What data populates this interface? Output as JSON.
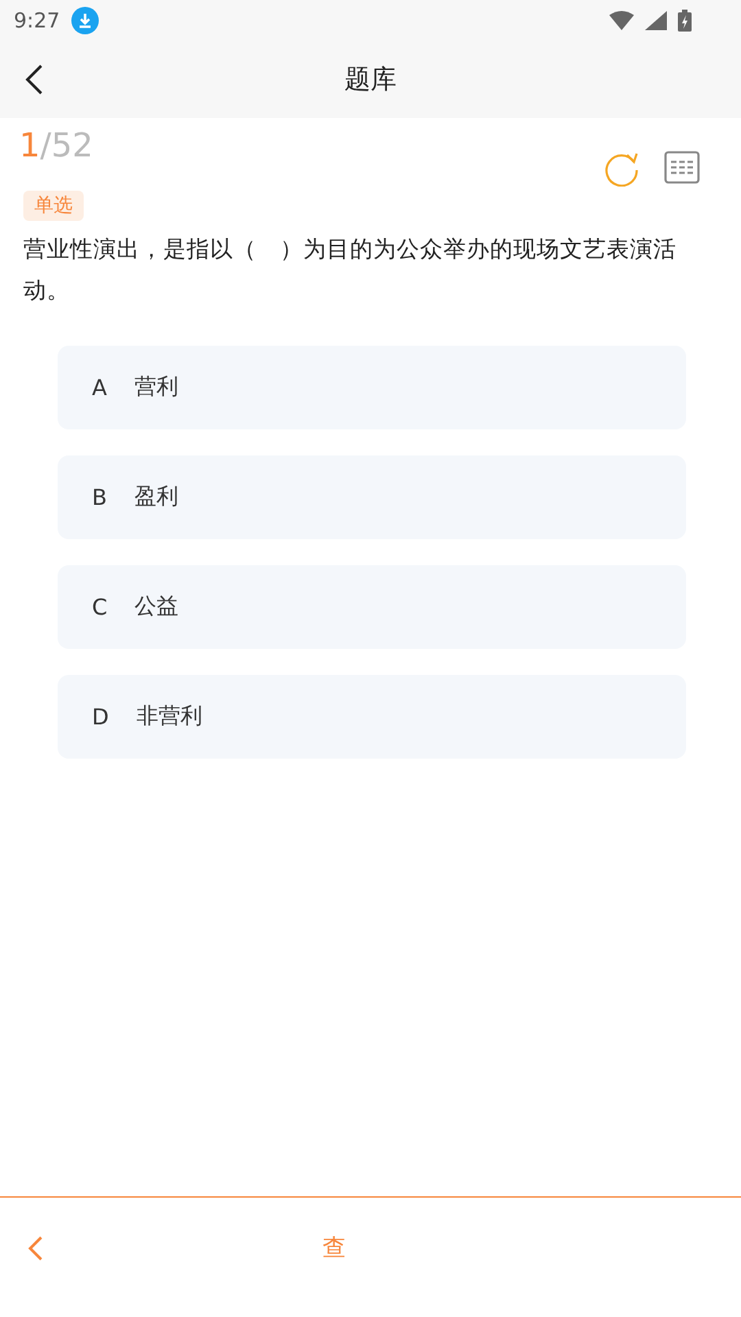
{
  "status_bar": {
    "time": "9:27"
  },
  "header": {
    "title": "题库"
  },
  "progress": {
    "current": "1",
    "total": "/52"
  },
  "question": {
    "type": "单选",
    "text": "营业性演出，是指以（　）为目的为公众举办的现场文艺表演活动。"
  },
  "options": [
    {
      "letter": "A",
      "text": "营利",
      "selected": false
    },
    {
      "letter": "B",
      "text": "盈利",
      "selected": false
    },
    {
      "letter": "C",
      "text": "公益",
      "selected": false
    },
    {
      "letter": "D",
      "text": "非营利",
      "selected": false
    }
  ],
  "footer": {
    "action": "查"
  }
}
